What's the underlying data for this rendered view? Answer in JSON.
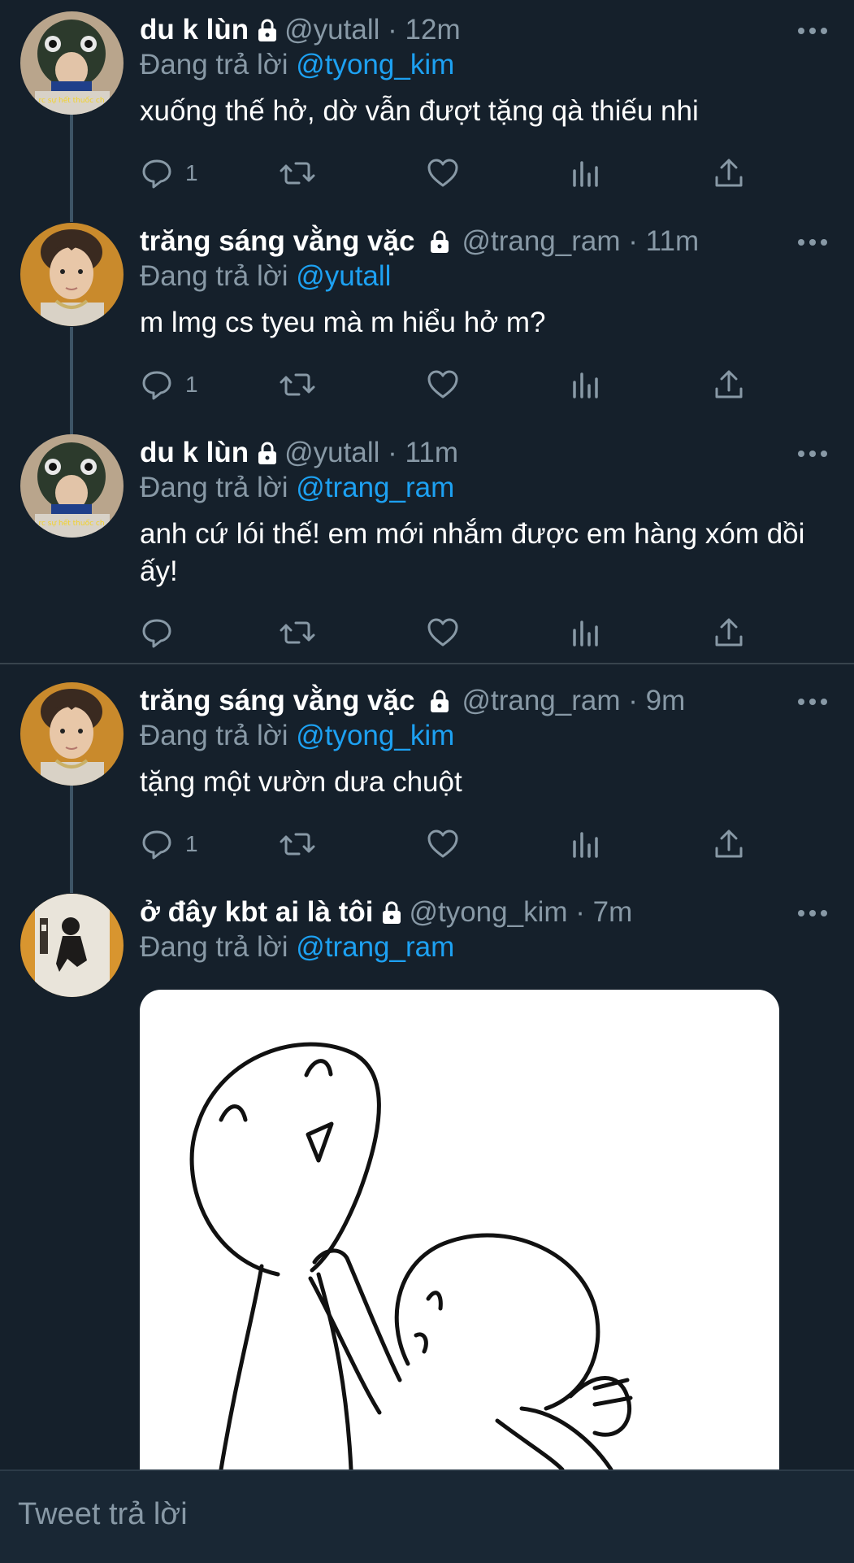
{
  "tweets": [
    {
      "name": "du k lùn",
      "handle": "@yutall",
      "dot": "·",
      "time": "12m",
      "replying_prefix": "Đang trả lời",
      "replying_to": "@tyong_kim",
      "text": "xuống thế hở, dờ vẫn đượt tặng qà thiếu nhi",
      "reply_count": "1",
      "avatar_caption": "rc sự hết thuốc ch"
    },
    {
      "name": "trăng sáng vằng vặc",
      "handle": "@trang_ram",
      "dot": "·",
      "time": "11m",
      "replying_prefix": "Đang trả lời",
      "replying_to": "@yutall",
      "text": "m lmg cs tyeu mà m hiểu hở m?",
      "reply_count": "1"
    },
    {
      "name": "du k lùn",
      "handle": "@yutall",
      "dot": "·",
      "time": "11m",
      "replying_prefix": "Đang trả lời",
      "replying_to": "@trang_ram",
      "text": "anh cứ lói thế! em mới nhắm được em hàng xóm dồi ấy!",
      "reply_count": "",
      "avatar_caption": "rc sự hết thuốc ch"
    },
    {
      "name": "trăng sáng vằng vặc",
      "handle": "@trang_ram",
      "dot": "·",
      "time": "9m",
      "replying_prefix": "Đang trả lời",
      "replying_to": "@tyong_kim",
      "text": "tặng một vườn dưa chuột",
      "reply_count": "1"
    },
    {
      "name": "ở đây kbt ai là tôi",
      "handle": "@tyong_kim",
      "dot": "·",
      "time": "7m",
      "replying_prefix": "Đang trả lời",
      "replying_to": "@trang_ram"
    }
  ],
  "reply_bar": {
    "placeholder": "Tweet trả lời"
  },
  "icons": {
    "reply": "reply-icon",
    "retweet": "retweet-icon",
    "like": "heart-icon",
    "analytics": "analytics-icon",
    "share": "share-icon",
    "more": "more-icon",
    "lock": "lock-icon"
  },
  "colors": {
    "background": "#15202b",
    "secondary_text": "#8899a6",
    "mention": "#1da1f2",
    "thread_line": "#3d5466"
  }
}
